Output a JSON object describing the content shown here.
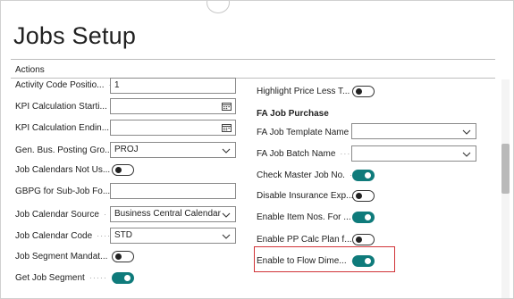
{
  "page": {
    "title": "Jobs Setup"
  },
  "actions": {
    "label": "Actions"
  },
  "left_fields": [
    {
      "label": "Activity Code Positio...",
      "type": "text",
      "value": "1"
    },
    {
      "label": "KPI Calculation Starti...",
      "type": "date",
      "value": ""
    },
    {
      "label": "KPI Calculation Endin...",
      "type": "date",
      "value": ""
    },
    {
      "label": "Gen. Bus. Posting Gro...",
      "type": "select",
      "value": "PROJ"
    },
    {
      "label": "Job Calendars Not Us...",
      "type": "toggle",
      "value": "off"
    },
    {
      "label": "GBPG for Sub-Job Fo...",
      "type": "text",
      "value": ""
    },
    {
      "label": "Job Calendar Source",
      "type": "select",
      "value": "Business Central Calendar"
    },
    {
      "label": "Job Calendar Code",
      "type": "select",
      "value": "STD"
    },
    {
      "label": "Job Segment Mandat...",
      "type": "toggle",
      "value": "off"
    },
    {
      "label": "Get Job Segment",
      "type": "toggle",
      "value": "on"
    }
  ],
  "right_top_field": {
    "label": "Highlight Price Less T...",
    "type": "toggle",
    "value": "off"
  },
  "fa_group": {
    "title": "FA Job Purchase",
    "fields": [
      {
        "label": "FA Job Template Name",
        "type": "select",
        "value": ""
      },
      {
        "label": "FA Job Batch Name",
        "type": "select",
        "value": ""
      },
      {
        "label": "Check Master Job No.",
        "type": "toggle",
        "value": "on"
      },
      {
        "label": "Disable Insurance Exp...",
        "type": "toggle",
        "value": "off"
      },
      {
        "label": "Enable Item Nos. For ...",
        "type": "toggle",
        "value": "on"
      },
      {
        "label": "Enable PP Calc Plan f...",
        "type": "toggle",
        "value": "off"
      },
      {
        "label": "Enable to Flow Dime...",
        "type": "toggle",
        "value": "on"
      }
    ]
  },
  "colors": {
    "toggle_on": "#0f7b7b",
    "highlight_border": "#d13438"
  }
}
